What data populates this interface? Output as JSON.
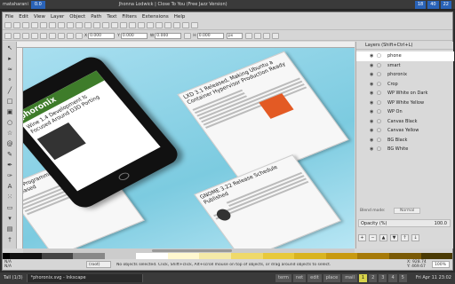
{
  "topbar": {
    "user": "mataharani",
    "volume": "0.0",
    "now_playing": "Jhonna Lodwick | Close To You (Free Jazz Version)",
    "stats": [
      "18",
      "40",
      "22"
    ]
  },
  "menu": [
    "File",
    "Edit",
    "View",
    "Layer",
    "Object",
    "Path",
    "Text",
    "Filters",
    "Extensions",
    "Help"
  ],
  "toolbar": {
    "x_label": "X",
    "x_value": "0.000",
    "y_label": "Y",
    "y_value": "0.000",
    "w_label": "W",
    "w_value": "0.000",
    "h_label": "H",
    "h_value": "0.000",
    "unit": "px"
  },
  "canvas": {
    "phone": {
      "brand": "phoronix",
      "headline": "Wine 1.4 Development Is Focused Around D3D Porting"
    },
    "card1": {
      "title": "LXD 3.1 Released, Making Ubuntu a Container Hypervisor Production Ready"
    },
    "card2": {
      "title": "Trust Programming Language 1.4 Released"
    },
    "card3": {
      "title": "GNOME 3.22 Release Schedule Published"
    }
  },
  "layers": {
    "title": "Layers (Shift+Ctrl+L)",
    "items": [
      "phone",
      "smart",
      "phoronix",
      "Crop",
      "WP White on Dark",
      "WP White Yellow",
      "WP On",
      "Canvas Black",
      "Canvas Yellow",
      "BG Black",
      "BG White"
    ],
    "blend_label": "Blend mode:",
    "blend_value": "Normal",
    "opacity_label": "Opacity (%)",
    "opacity_value": "100.0"
  },
  "status": {
    "fill": "N/A",
    "stroke": "N/A",
    "layer": "(root)",
    "message": "No objects selected. Click, Shift+click, Alt+scroll mouse on top of objects, or drag around objects to select.",
    "x": "X: 928.74",
    "y": "Y: 469.67",
    "zoom": "100%"
  },
  "taskbar": {
    "tasks": [
      "Tall (1/3)",
      "*phoronix.svg - Inkscape"
    ],
    "workspaces": [
      "term",
      "net",
      "edit",
      "place",
      "mail",
      "1",
      "2",
      "3",
      "4",
      "5"
    ],
    "active_ws": "1",
    "clock": "Fri Apr 11 23:02"
  },
  "colors": {
    "accent": "#2a63b8",
    "phoronix_green": "#3e7c2a",
    "canvas_bg": "#8fd2e2"
  }
}
